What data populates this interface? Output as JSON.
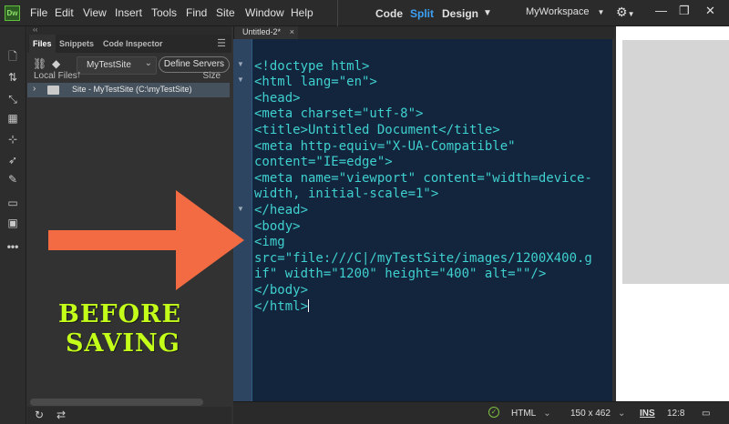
{
  "app": {
    "logo": "Dw"
  },
  "menu": [
    "File",
    "Edit",
    "View",
    "Insert",
    "Tools",
    "Find",
    "Site",
    "Window",
    "Help"
  ],
  "view_modes": {
    "code": "Code",
    "split": "Split",
    "design": "Design",
    "active": "Split"
  },
  "workspace": "MyWorkspace",
  "panel": {
    "tabs": [
      "Files",
      "Snippets",
      "Code Inspector"
    ],
    "active_tab": "Files",
    "site_select": "MyTestSite",
    "define_servers": "Define Servers",
    "column_local": "Local Files",
    "column_size": "Size",
    "tree": [
      {
        "label": "Site - MyTestSite (C:\\myTestSite)",
        "expanded": false
      }
    ]
  },
  "annotation": {
    "line1": "BEFORE",
    "line2": "SAVING",
    "color": "#c4ff1a",
    "arrow_color": "#f26b43"
  },
  "document": {
    "tab_title": "Untitled-2*",
    "close_icon": "×"
  },
  "code_lines": [
    "<!doctype html>",
    "<html lang=\"en\">",
    "<head>",
    "<meta charset=\"utf-8\">",
    "<title>Untitled Document</title>",
    "<meta http-equiv=\"X-UA-Compatible\"",
    "content=\"IE=edge\">",
    "<meta name=\"viewport\" content=\"width=device-",
    "width, initial-scale=1\">",
    "</head>",
    "<body>",
    "<img",
    "src=\"file:///C|/myTestSite/images/1200X400.g",
    "if\" width=\"1200\" height=\"400\" alt=\"\"/>",
    "</body>",
    "</html>"
  ],
  "status": {
    "language": "HTML",
    "dimensions": "150 x 462",
    "mode": "INS",
    "position": "12:8"
  }
}
